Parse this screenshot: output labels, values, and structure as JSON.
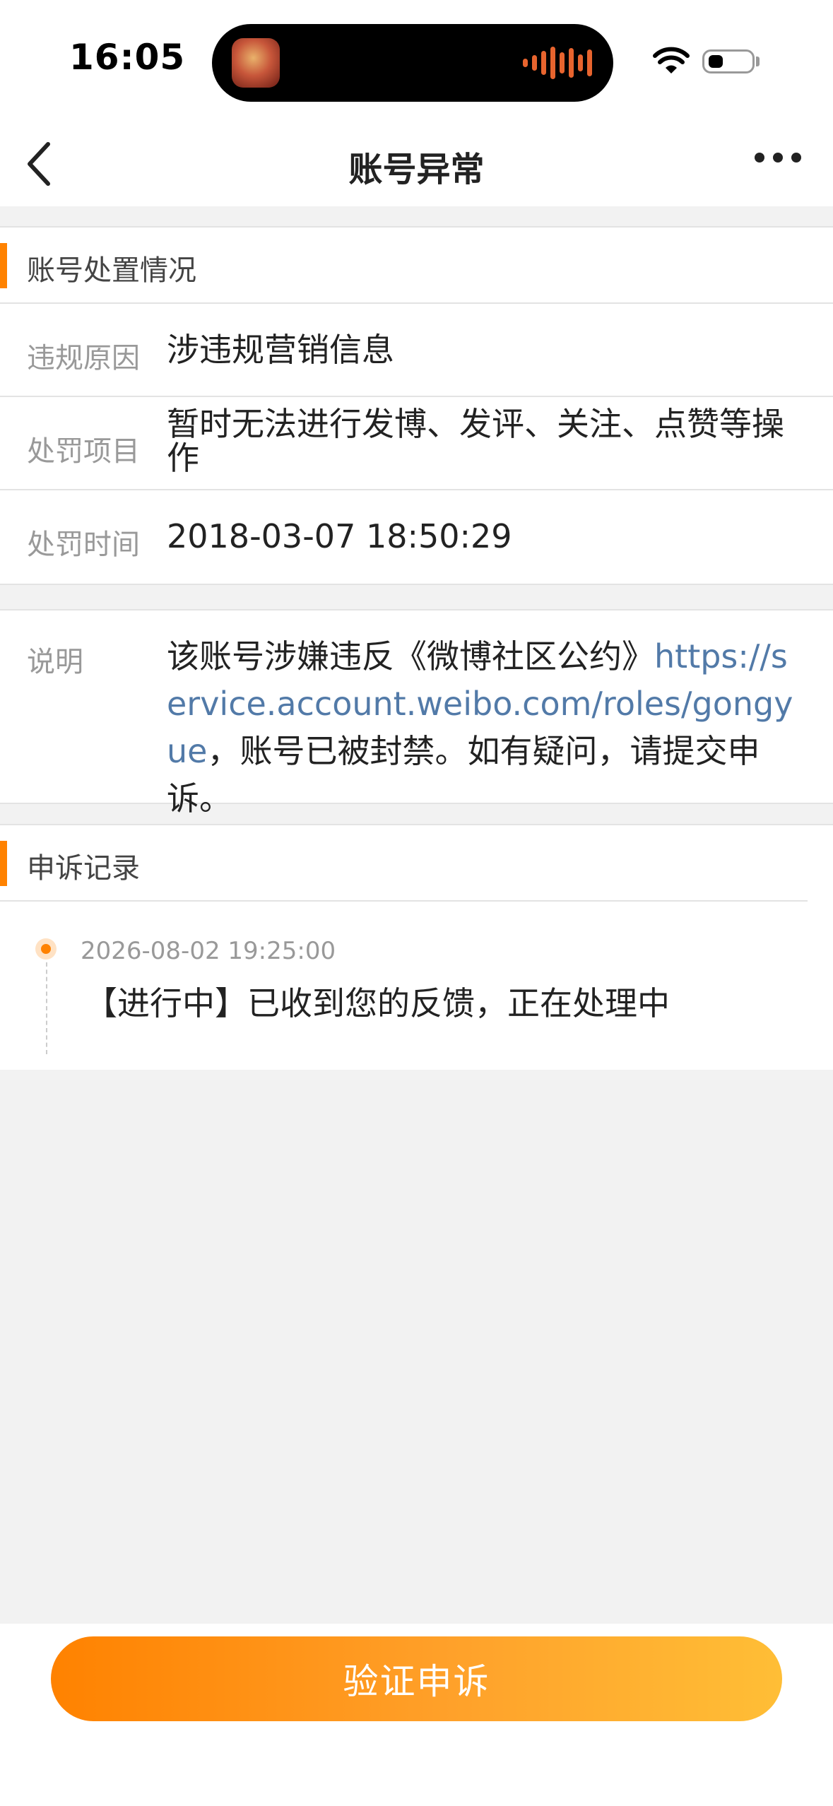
{
  "status_bar": {
    "time": "16:05"
  },
  "nav": {
    "title": "账号异常"
  },
  "account_status": {
    "header": "账号处置情况",
    "rows": [
      {
        "label": "违规原因",
        "value": "涉违规营销信息"
      },
      {
        "label": "处罚项目",
        "value": "暂时无法进行发博、发评、关注、点赞等操作"
      },
      {
        "label": "处罚时间",
        "value": "2018-03-07 18:50:29"
      }
    ]
  },
  "explanation": {
    "label": "说明",
    "text_before": "该账号涉嫌违反《微博社区公约》",
    "link": "https://service.account.weibo.com/roles/gongyue",
    "text_after": "，账号已被封禁。如有疑问，请提交申诉。"
  },
  "appeal_records": {
    "header": "申诉记录",
    "items": [
      {
        "time": "2026-08-02 19:25:00",
        "text": "【进行中】已收到您的反馈，正在处理中"
      }
    ]
  },
  "button": {
    "label": "验证申诉"
  },
  "colors": {
    "accent": "#ff8200",
    "link": "#527aa8",
    "background": "#f2f2f2"
  }
}
